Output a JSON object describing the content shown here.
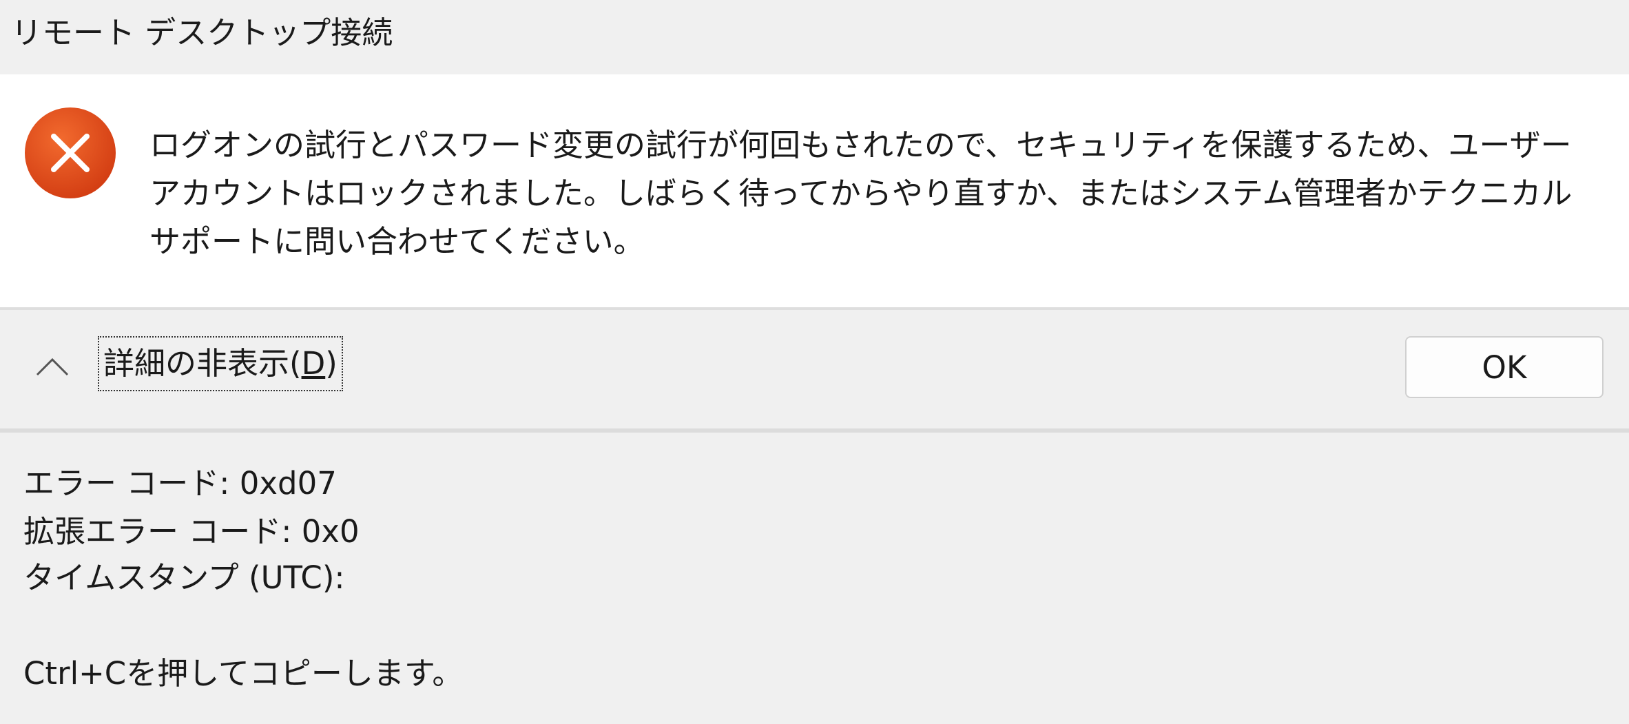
{
  "window": {
    "title": "リモート デスクトップ接続"
  },
  "message": {
    "icon": "error-icon",
    "text": "ログオンの試行とパスワード変更の試行が何回もされたので、セキュリティを保護するため、ユーザー アカウントはロックされました。しばらく待ってからやり直すか、またはシステム管理者かテクニカル サポートに問い合わせてください。"
  },
  "buttons": {
    "details_toggle_label": "詳細の非表示(",
    "details_toggle_mnemonic": "D",
    "details_toggle_suffix": ")",
    "ok_label": "OK"
  },
  "details": {
    "error_code": "エラー コード: 0xd07",
    "extended_error_code": "拡張エラー コード: 0x0",
    "timestamp": "タイムスタンプ (UTC):",
    "copy_hint": "Ctrl+Cを押してコピーします。"
  },
  "colors": {
    "error_icon": "#e0491e",
    "message_background": "#ffffff",
    "dialog_background": "#f0f0f0"
  }
}
